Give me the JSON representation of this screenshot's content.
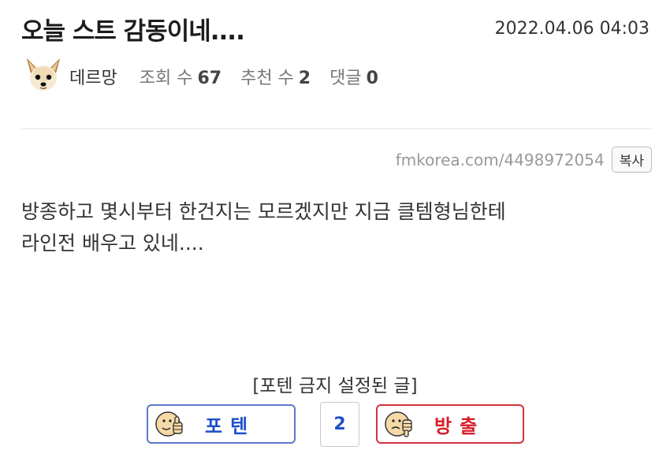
{
  "post": {
    "title": "오늘 스트 감동이네....",
    "date": "2022.04.06 04:03",
    "author": "데르망",
    "views_label": "조회 수",
    "views": "67",
    "recommend_label": "추천 수",
    "recommend": "2",
    "comments_label": "댓글",
    "comments": "0",
    "url": "fmkorea.com/4498972054",
    "copy_label": "복사",
    "content_lines": [
      "방종하고 몇시부터 한건지는 모르겠지만 지금 클템형님한테",
      "라인전 배우고 있네...."
    ]
  },
  "vote": {
    "notice": "[포텐 금지 설정된 글]",
    "up_label": "포텐",
    "count": "2",
    "down_label": "방출",
    "up_color": "#1e50c8",
    "down_color": "#d81e28"
  },
  "icons": {
    "avatar": "dog-avatar",
    "vote_face": "thumb-face-icon"
  }
}
